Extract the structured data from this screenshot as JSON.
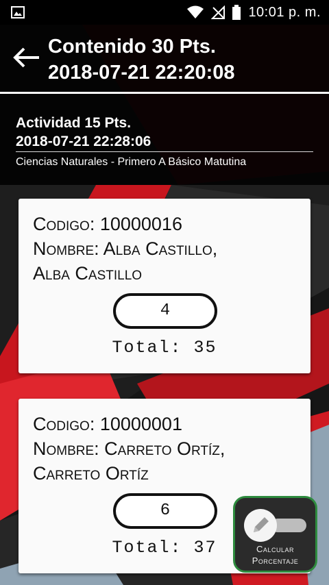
{
  "status_bar": {
    "time": "10:01 p. m.",
    "icons": [
      "image-icon",
      "wifi-icon",
      "no-signal-icon",
      "battery-icon"
    ]
  },
  "header": {
    "title_line1": "Contenido 30 Pts.",
    "title_line2": "2018-07-21 22:20:08"
  },
  "activity": {
    "title": "Actividad 15 Pts.",
    "datetime": "2018-07-21 22:28:06",
    "subtitle": "Ciencias Naturales - Primero A Básico Matutina"
  },
  "students": [
    {
      "codigo_line": "Codigo: 10000016",
      "nombre_line1": "Nombre: Alba Castillo,",
      "nombre_line2": "Alba Castillo",
      "score": "4",
      "total": "Total: 35"
    },
    {
      "codigo_line": "Codigo: 10000001",
      "nombre_line1": "Nombre: Carreto Ortíz,",
      "nombre_line2": "Carreto Ortíz",
      "score": "6",
      "total": "Total: 37"
    }
  ],
  "calc_button": {
    "line1": "Calcular",
    "line2": "Porcentaje"
  },
  "colors": {
    "accent_red": "#d11a22",
    "button_border": "#2e8b3e",
    "header_bg": "#000000"
  }
}
